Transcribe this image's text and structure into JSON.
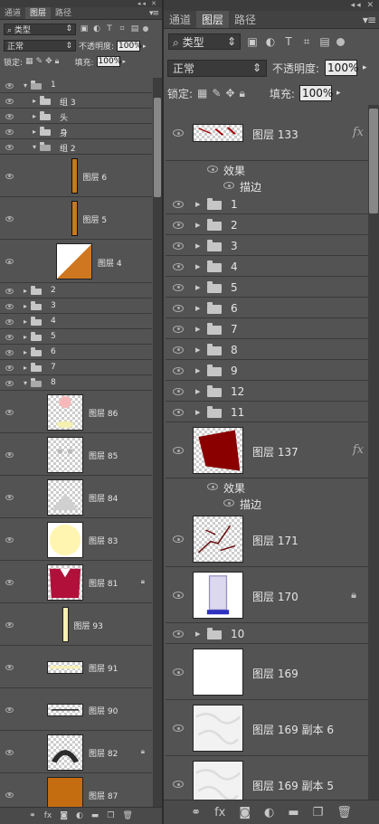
{
  "left": {
    "tabs": [
      "通道",
      "图层",
      "路径"
    ],
    "filter": {
      "icon": "search-icon",
      "label": "类型"
    },
    "blend_mode": "正常",
    "opacity_label": "不透明度:",
    "opacity": "100%",
    "lock_label": "锁定:",
    "fill_label": "填充:",
    "fill": "100%",
    "layers": [
      {
        "name": "1",
        "kind": "group",
        "open": true,
        "indent": 0,
        "h": 17
      },
      {
        "name": "组 3",
        "kind": "group",
        "open": false,
        "indent": 1,
        "h": 17
      },
      {
        "name": "头",
        "kind": "group",
        "open": false,
        "indent": 1,
        "h": 17
      },
      {
        "name": "身",
        "kind": "group",
        "open": false,
        "indent": 1,
        "h": 17
      },
      {
        "name": "组 2",
        "kind": "group",
        "open": true,
        "indent": 1,
        "h": 17
      },
      {
        "name": "图层 6",
        "kind": "layer",
        "indent": 2,
        "h": 47,
        "thumb": "bar-orange"
      },
      {
        "name": "图层 5",
        "kind": "layer",
        "indent": 2,
        "h": 47,
        "thumb": "bar-orange"
      },
      {
        "name": "图层 4",
        "kind": "layer",
        "indent": 2,
        "h": 48,
        "thumb": "tri-orange"
      },
      {
        "name": "2",
        "kind": "group",
        "open": false,
        "indent": 0,
        "h": 17
      },
      {
        "name": "3",
        "kind": "group",
        "open": false,
        "indent": 0,
        "h": 17
      },
      {
        "name": "4",
        "kind": "group",
        "open": false,
        "indent": 0,
        "h": 17
      },
      {
        "name": "5",
        "kind": "group",
        "open": false,
        "indent": 0,
        "h": 17
      },
      {
        "name": "6",
        "kind": "group",
        "open": false,
        "indent": 0,
        "h": 17
      },
      {
        "name": "7",
        "kind": "group",
        "open": false,
        "indent": 0,
        "h": 17
      },
      {
        "name": "8",
        "kind": "group",
        "open": true,
        "indent": 0,
        "h": 17
      },
      {
        "name": "图层 86",
        "kind": "layer",
        "indent": 1,
        "h": 47,
        "thumb": "pink"
      },
      {
        "name": "图层 85",
        "kind": "layer",
        "indent": 1,
        "h": 47,
        "thumb": "faint"
      },
      {
        "name": "图层 84",
        "kind": "layer",
        "indent": 1,
        "h": 47,
        "thumb": "grey"
      },
      {
        "name": "图层 83",
        "kind": "layer",
        "indent": 1,
        "h": 47,
        "thumb": "cream"
      },
      {
        "name": "图层 81",
        "kind": "layer",
        "indent": 1,
        "h": 47,
        "thumb": "red",
        "lock": true
      },
      {
        "name": "图层 93",
        "kind": "layer",
        "indent": 1,
        "h": 47,
        "thumb": "bar-cream"
      },
      {
        "name": "图层 91",
        "kind": "layer",
        "indent": 1,
        "h": 47,
        "thumb": "strip-cream"
      },
      {
        "name": "图层 90",
        "kind": "layer",
        "indent": 1,
        "h": 47,
        "thumb": "strip-dark"
      },
      {
        "name": "图层 82",
        "kind": "layer",
        "indent": 1,
        "h": 47,
        "thumb": "dark",
        "lock": true
      },
      {
        "name": "图层 87",
        "kind": "layer",
        "indent": 1,
        "h": 47,
        "thumb": "brown"
      }
    ],
    "bottom_icons": [
      "link-icon",
      "fx-icon",
      "mask-icon",
      "adjustment-icon",
      "folder-icon",
      "new-layer-icon",
      "trash-icon"
    ]
  },
  "right": {
    "tabs": [
      "通道",
      "图层",
      "路径"
    ],
    "filter": {
      "icon": "search-icon",
      "label": "类型"
    },
    "blend_mode": "正常",
    "opacity_label": "不透明度:",
    "opacity": "100%",
    "lock_label": "锁定:",
    "fill_label": "填充:",
    "fill": "100%",
    "layers": [
      {
        "name": "图层 133",
        "kind": "layer",
        "h": 62,
        "thumb": "stroke-red",
        "fx": true
      },
      {
        "name": "效果",
        "kind": "effect",
        "h": 18
      },
      {
        "name": "描边",
        "kind": "effect-item",
        "h": 18
      },
      {
        "name": "1",
        "kind": "group",
        "open": false,
        "h": 23
      },
      {
        "name": "2",
        "kind": "group",
        "open": false,
        "h": 23
      },
      {
        "name": "3",
        "kind": "group",
        "open": false,
        "h": 23
      },
      {
        "name": "4",
        "kind": "group",
        "open": false,
        "h": 23
      },
      {
        "name": "5",
        "kind": "group",
        "open": false,
        "h": 23
      },
      {
        "name": "6",
        "kind": "group",
        "open": false,
        "h": 23
      },
      {
        "name": "7",
        "kind": "group",
        "open": false,
        "h": 23
      },
      {
        "name": "8",
        "kind": "group",
        "open": false,
        "h": 23
      },
      {
        "name": "9",
        "kind": "group",
        "open": false,
        "h": 23
      },
      {
        "name": "12",
        "kind": "group",
        "open": false,
        "h": 23
      },
      {
        "name": "11",
        "kind": "group",
        "open": false,
        "h": 23
      },
      {
        "name": "图层 137",
        "kind": "layer",
        "h": 62,
        "thumb": "darkred",
        "fx": true
      },
      {
        "name": "效果",
        "kind": "effect",
        "h": 18
      },
      {
        "name": "描边",
        "kind": "effect-item",
        "h": 18
      },
      {
        "name": "图层 171",
        "kind": "layer",
        "h": 62,
        "thumb": "cracks"
      },
      {
        "name": "图层 170",
        "kind": "layer",
        "h": 62,
        "thumb": "bottle",
        "lock": true
      },
      {
        "name": "10",
        "kind": "group",
        "open": false,
        "h": 23
      },
      {
        "name": "图层 169",
        "kind": "layer",
        "h": 62,
        "thumb": "white"
      },
      {
        "name": "图层 169 副本 6",
        "kind": "layer",
        "h": 62,
        "thumb": "marble"
      },
      {
        "name": "图层 169 副本 5",
        "kind": "layer",
        "h": 62,
        "thumb": "marble"
      }
    ],
    "bottom_icons": [
      "link-icon",
      "fx-icon",
      "mask-icon",
      "adjustment-icon",
      "folder-icon",
      "new-layer-icon",
      "trash-icon"
    ]
  }
}
